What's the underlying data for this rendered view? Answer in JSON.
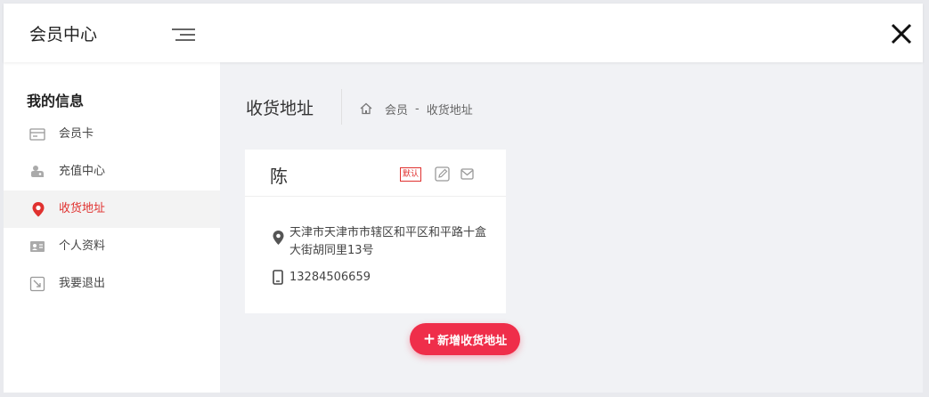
{
  "header": {
    "title": "会员中心",
    "menu_icon": "menu-icon",
    "close_icon": "close-icon"
  },
  "sidebar": {
    "heading": "我的信息",
    "items": [
      {
        "label": "会员卡",
        "icon": "card-icon",
        "active": false
      },
      {
        "label": "充值中心",
        "icon": "wallet-icon",
        "active": false
      },
      {
        "label": "收货地址",
        "icon": "location-pin-icon",
        "active": true
      },
      {
        "label": "个人资料",
        "icon": "profile-icon",
        "active": false
      },
      {
        "label": "我要退出",
        "icon": "exit-icon",
        "active": false
      }
    ]
  },
  "main": {
    "page_title": "收货地址",
    "breadcrumb": {
      "home_icon": "home-icon",
      "item1": "会员",
      "separator": "-",
      "item2": "收货地址"
    },
    "address_card": {
      "name": "陈",
      "default_badge": "默认",
      "address": "天津市天津市市辖区和平区和平路十盒大街胡同里13号",
      "phone": "13284506659"
    },
    "add_button": {
      "plus": "+",
      "label": "新增收货地址"
    }
  },
  "colors": {
    "accent": "#e0312f",
    "button": "#ef2e4a",
    "main_bg": "#f1f2f5"
  }
}
